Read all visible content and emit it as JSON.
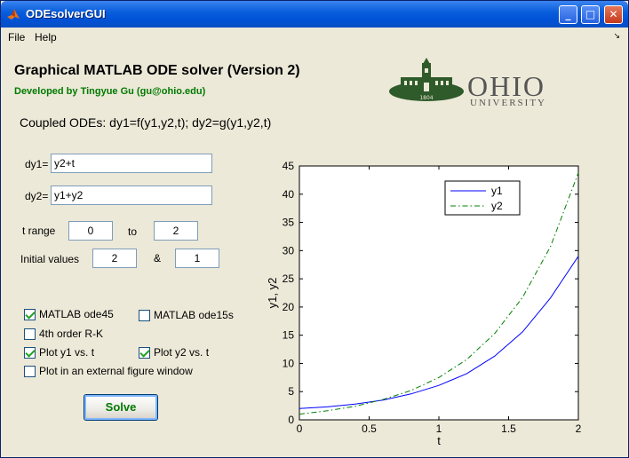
{
  "window": {
    "title": "ODEsolverGUI",
    "controls": {
      "minimize": "_",
      "maximize": "□",
      "close": "✕"
    }
  },
  "menu": {
    "items": [
      "File",
      "Help"
    ],
    "arrow": "↘"
  },
  "header": {
    "title": "Graphical MATLAB ODE solver (Version 2)",
    "author": "Developed by Tingyue Gu (gu@ohio.edu)",
    "logo_text": "OHIO",
    "logo_sub": "UNIVERSITY",
    "logo_year": "1804"
  },
  "coupled": "Coupled ODEs: dy1=f(y1,y2,t); dy2=g(y1,y2,t)",
  "inputs": {
    "dy1_label": "dy1=",
    "dy1_value": "y2+t",
    "dy2_label": "dy2=",
    "dy2_value": "y1+y2",
    "trange_label": "t range",
    "t_start": "0",
    "to_label": "to",
    "t_end": "2",
    "init_label": "Initial values",
    "init1": "2",
    "amp_label": "&",
    "init2": "1"
  },
  "options": {
    "ode45": {
      "label": "MATLAB ode45",
      "checked": true
    },
    "ode15s": {
      "label": "MATLAB ode15s",
      "checked": false
    },
    "rk4": {
      "label": "4th order R-K",
      "checked": false
    },
    "plot_y1": {
      "label": "Plot y1 vs. t",
      "checked": true
    },
    "plot_y2": {
      "label": "Plot y2 vs. t",
      "checked": true
    },
    "external": {
      "label": "Plot in an external figure window",
      "checked": false
    }
  },
  "solve_label": "Solve",
  "chart_data": {
    "type": "line",
    "xlabel": "t",
    "ylabel": "y1, y2",
    "xlim": [
      0,
      2
    ],
    "ylim": [
      0,
      45
    ],
    "xticks": [
      0,
      0.5,
      1,
      1.5,
      2
    ],
    "yticks": [
      0,
      5,
      10,
      15,
      20,
      25,
      30,
      35,
      40,
      45
    ],
    "legend_position": "top-right",
    "series": [
      {
        "name": "y1",
        "color": "#0000ff",
        "style": "solid",
        "x": [
          0,
          0.2,
          0.4,
          0.6,
          0.8,
          1.0,
          1.2,
          1.4,
          1.6,
          1.8,
          2.0
        ],
        "y": [
          2.0,
          2.3,
          2.8,
          3.5,
          4.6,
          6.1,
          8.2,
          11.3,
          15.6,
          21.6,
          29.0
        ]
      },
      {
        "name": "y2",
        "color": "#008000",
        "style": "dashdot",
        "x": [
          0,
          0.2,
          0.4,
          0.6,
          0.8,
          1.0,
          1.2,
          1.4,
          1.6,
          1.8,
          2.0
        ],
        "y": [
          1.0,
          1.6,
          2.4,
          3.6,
          5.2,
          7.5,
          10.7,
          15.3,
          21.7,
          30.7,
          43.8
        ]
      }
    ]
  }
}
